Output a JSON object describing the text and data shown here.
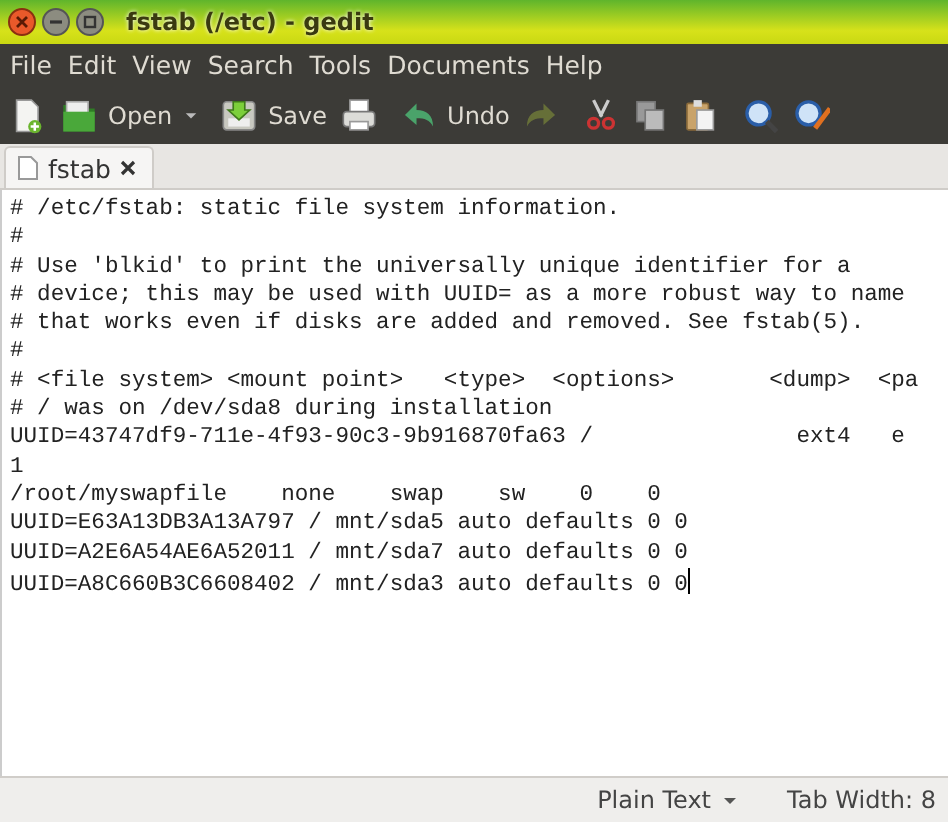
{
  "window": {
    "title": "fstab (/etc) - gedit"
  },
  "menu": [
    "File",
    "Edit",
    "View",
    "Search",
    "Tools",
    "Documents",
    "Help"
  ],
  "toolbar": [
    {
      "kind": "new",
      "disabled": false
    },
    {
      "kind": "open",
      "label": "Open",
      "disabled": false
    },
    {
      "kind": "dropdown",
      "disabled": false
    },
    {
      "kind": "save",
      "label": "Save",
      "disabled": false
    },
    {
      "kind": "print",
      "disabled": false
    },
    {
      "kind": "undo",
      "label": "Undo",
      "disabled": false
    },
    {
      "kind": "redo",
      "disabled": true
    },
    {
      "kind": "cut",
      "disabled": false
    },
    {
      "kind": "copy",
      "disabled": false
    },
    {
      "kind": "paste",
      "disabled": false
    },
    {
      "kind": "find",
      "disabled": false
    },
    {
      "kind": "replace",
      "disabled": false
    }
  ],
  "tabs": [
    {
      "label": "fstab",
      "selected": true
    }
  ],
  "editor": {
    "lines": [
      "# /etc/fstab: static file system information.",
      "#",
      "# Use 'blkid' to print the universally unique identifier for a",
      "# device; this may be used with UUID= as a more robust way to name",
      "# that works even if disks are added and removed. See fstab(5).",
      "#",
      "# <file system> <mount point>   <type>  <options>       <dump>  <pa",
      "# / was on /dev/sda8 during installation",
      "UUID=43747df9-711e-4f93-90c3-9b916870fa63 /               ext4   e",
      "1",
      "/root/myswapfile    none    swap    sw    0    0",
      "UUID=E63A13DB3A13A797 / mnt/sda5 auto defaults 0 0",
      "UUID=A2E6A54AE6A52011 / mnt/sda7 auto defaults 0 0",
      "UUID=A8C660B3C6608402 / mnt/sda3 auto defaults 0 0"
    ],
    "cursor_at_end": true
  },
  "status_bar": {
    "language": "Plain Text",
    "tab_width": "Tab Width: 8"
  }
}
